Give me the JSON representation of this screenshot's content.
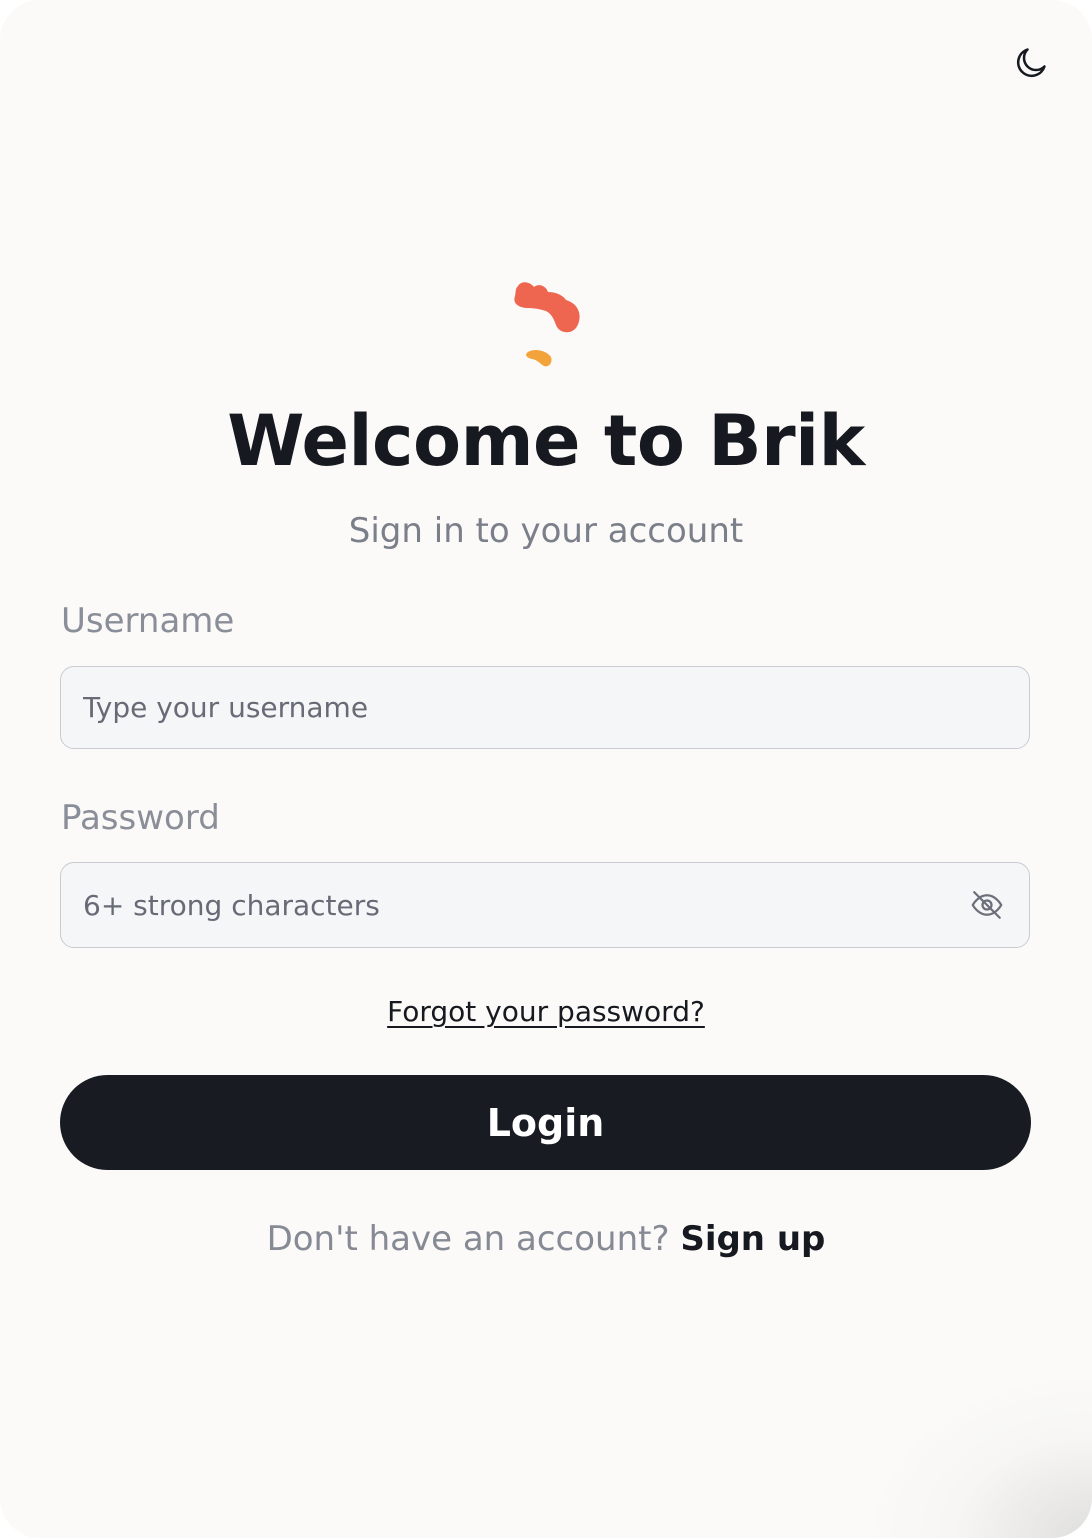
{
  "header": {
    "theme_toggle_icon": "moon-icon"
  },
  "brand": {
    "logo_icon": "brik-logo",
    "logo_colors": [
      "#ef6650",
      "#f2a43a"
    ],
    "title": "Welcome to Brik",
    "subtitle": "Sign in to your account"
  },
  "form": {
    "username": {
      "label": "Username",
      "placeholder": "Type your username",
      "value": ""
    },
    "password": {
      "label": "Password",
      "placeholder": "6+ strong characters",
      "value": "",
      "visibility_icon": "eye-off-icon"
    },
    "forgot_password": "Forgot your password?",
    "login_label": "Login"
  },
  "footer": {
    "prompt": "Don't have an account?",
    "signup_link": "Sign up"
  },
  "colors": {
    "primary_button": "#181b22",
    "background": "#fbfaf8",
    "input_background": "#f5f6f8"
  }
}
